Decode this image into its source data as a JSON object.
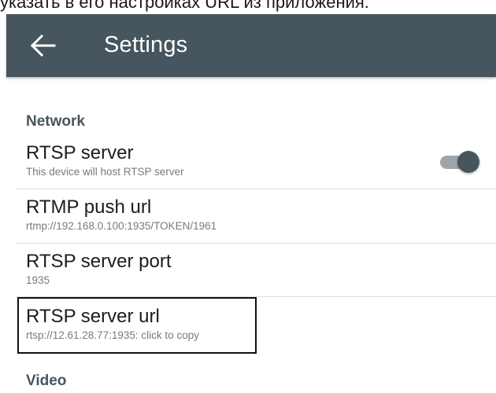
{
  "caption_text": "указать в его настройках URL из приложения.",
  "appbar": {
    "title": "Settings",
    "background_color": "#46555e",
    "back_icon": "arrow-left-icon"
  },
  "sections": {
    "network": {
      "header": "Network",
      "rtsp_server": {
        "title": "RTSP server",
        "summary": "This device will host RTSP server",
        "switch_state": "on"
      },
      "rtmp_push_url": {
        "title": "RTMP push url",
        "summary": "rtmp://192.168.0.100:1935/TOKEN/1961"
      },
      "rtsp_server_port": {
        "title": "RTSP server port",
        "summary": "1935"
      },
      "rtsp_server_url": {
        "title": "RTSP server url",
        "summary": "rtsp://12.61.28.77:1935: click to copy"
      }
    },
    "video": {
      "header": "Video"
    }
  },
  "colors": {
    "accent": "#46555e",
    "switch_track": "#9fa6ab",
    "highlight_border": "#111111"
  }
}
